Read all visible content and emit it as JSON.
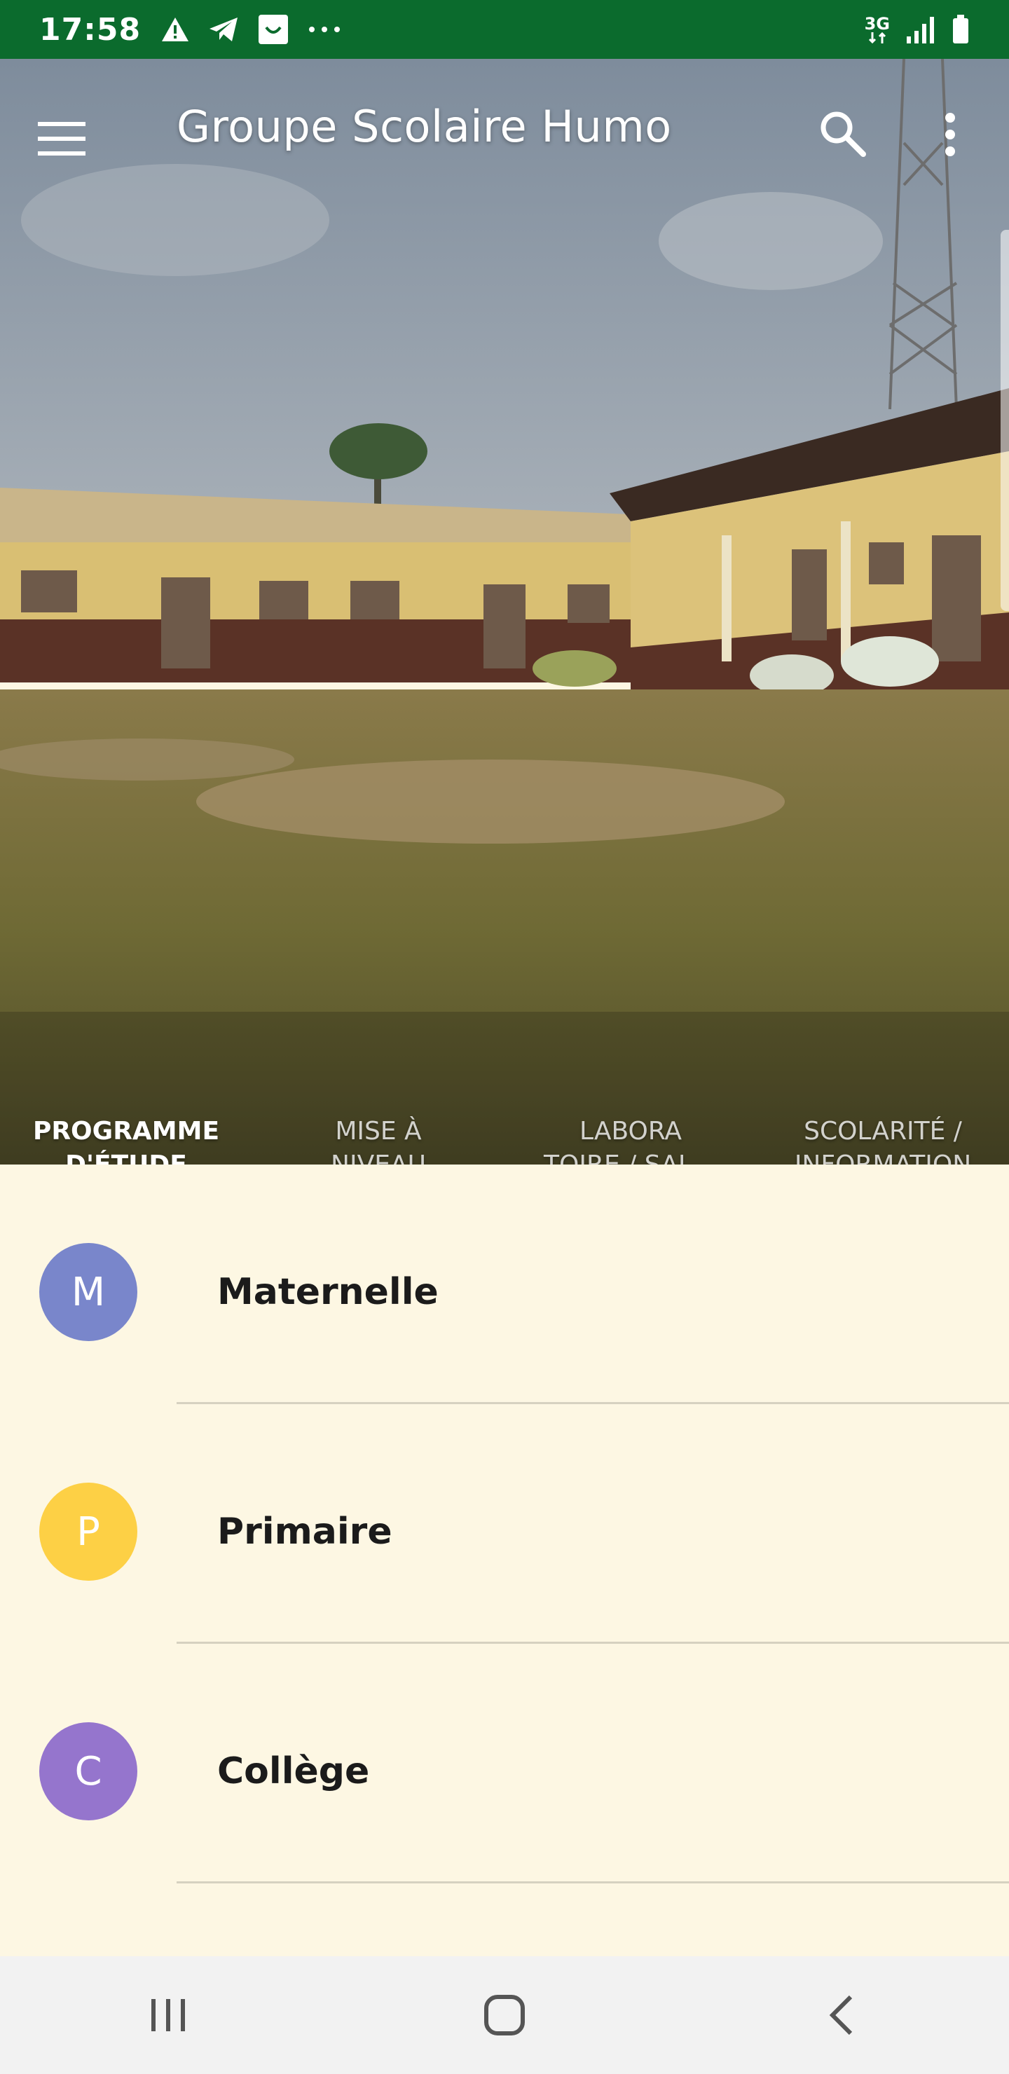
{
  "status_bar": {
    "time": "17:58",
    "network": "3G",
    "icons_left": [
      "warning-icon",
      "telegram-icon",
      "app-notification-icon",
      "more-notifications-icon"
    ],
    "icons_right": [
      "3g-data-icon",
      "signal-icon",
      "battery-icon"
    ]
  },
  "app_bar": {
    "title": "Groupe Scolaire Humo",
    "icons": [
      "menu-icon",
      "search-icon",
      "more-vert-icon"
    ]
  },
  "tabs": [
    {
      "label": "PROGRAMME\nD'ÉTUDE",
      "active": true
    },
    {
      "label": "MISE À\nNIVEAU",
      "active": false
    },
    {
      "label": "LABORA\nTOIRE / SAL…",
      "active": false
    },
    {
      "label": "SCOLARITÉ /\nINFORMATION",
      "active": false
    }
  ],
  "list": [
    {
      "initial": "M",
      "label": "Maternelle",
      "color": "#7986cb"
    },
    {
      "initial": "P",
      "label": "Primaire",
      "color": "#fdd045"
    },
    {
      "initial": "C",
      "label": "Collège",
      "color": "#9575cd"
    }
  ],
  "colors": {
    "status_bar": "#0b6b2d",
    "content_background": "#fdf7e3",
    "nav_bar": "#f2f2f2"
  },
  "nav_bar": {
    "buttons": [
      "recent-apps-icon",
      "home-icon",
      "back-icon"
    ]
  }
}
